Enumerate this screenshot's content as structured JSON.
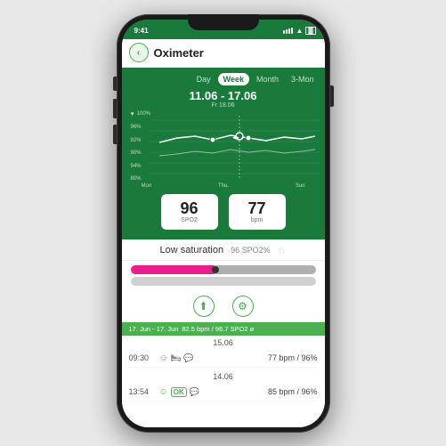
{
  "status_bar": {
    "time": "9:41",
    "signal": "●●●●",
    "wifi": "wifi",
    "battery": "battery"
  },
  "header": {
    "back_label": "‹",
    "title": "Oximeter"
  },
  "tabs": [
    {
      "id": "day",
      "label": "Day"
    },
    {
      "id": "week",
      "label": "Week",
      "active": true
    },
    {
      "id": "month",
      "label": "Month"
    },
    {
      "id": "3mon",
      "label": "3-Mon"
    }
  ],
  "date_range": "11.06 - 17.06",
  "date_sub": "Fr 18.06",
  "chart": {
    "y_labels": [
      "100%",
      "96%",
      "92%",
      "90%",
      "94%",
      "80%"
    ],
    "x_labels": [
      "Mon",
      "Thu.",
      "Sun"
    ]
  },
  "metrics": {
    "spo2": {
      "value": "96",
      "label": "SPO2"
    },
    "bpm": {
      "value": "77",
      "label": "bpm"
    }
  },
  "low_saturation": {
    "text": "Low saturation",
    "value": "96 SPO2%"
  },
  "footer_range": "17. Jun - 17. Jun",
  "footer_stats": "82.5 bpm / 96.7 SPO2 ø",
  "time_sections": [
    {
      "time_header": "15.06",
      "entries": [
        {
          "time": "09:30",
          "readings": "77 bpm / 96%"
        },
        {
          "time": "",
          "readings": ""
        }
      ]
    },
    {
      "time_header": "14.06",
      "entries": [
        {
          "time": "13:54",
          "ok": true,
          "readings": "85 bpm / 96%"
        }
      ]
    }
  ],
  "control_icons": {
    "up": "⬆",
    "gear": "⚙"
  }
}
